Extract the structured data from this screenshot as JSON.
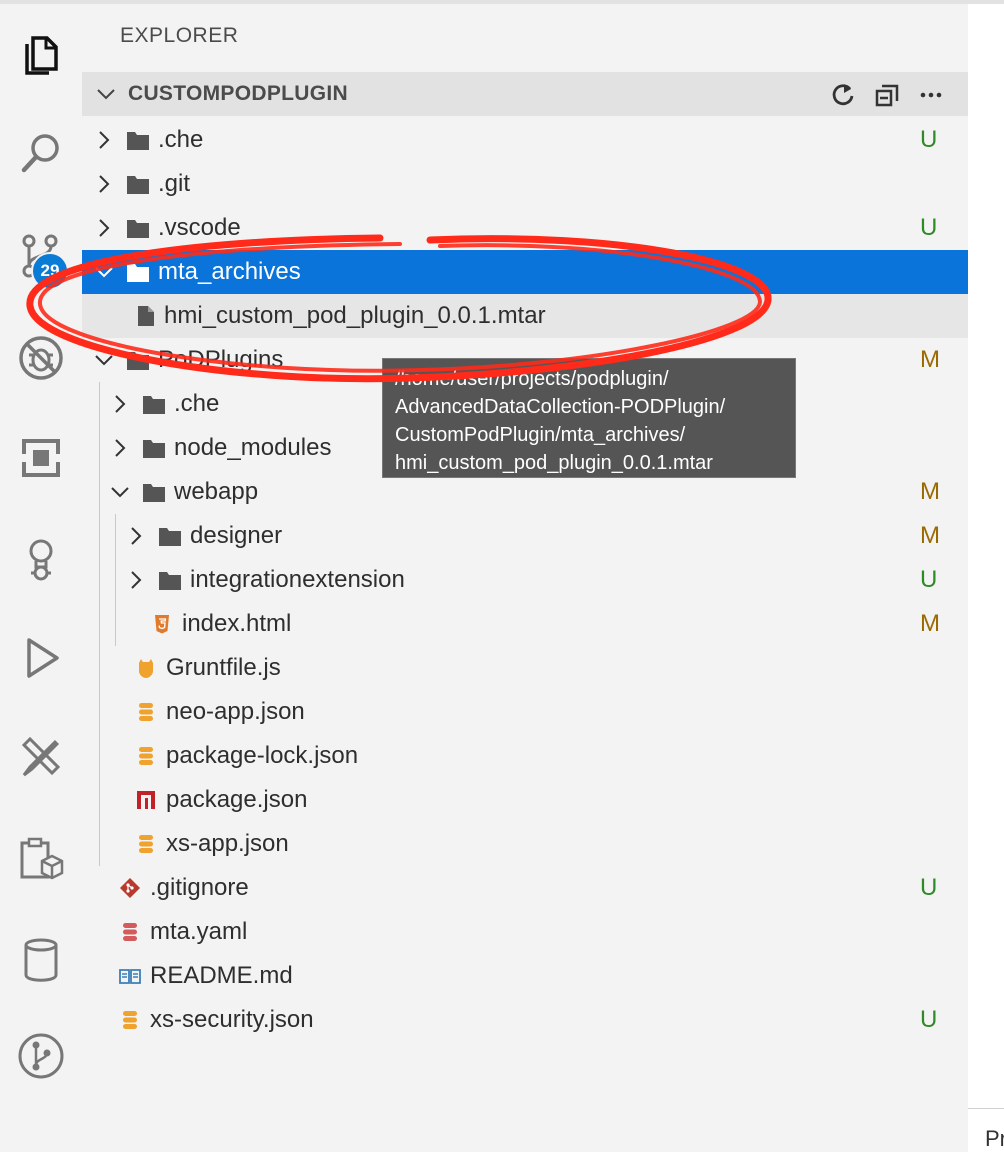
{
  "explorer": {
    "title": "EXPLORER"
  },
  "activity_bar": {
    "items": [
      {
        "icon": "files-icon"
      },
      {
        "icon": "search-icon"
      },
      {
        "icon": "source-control-icon",
        "badge": "29"
      },
      {
        "icon": "debug-disabled-icon"
      },
      {
        "icon": "extensions-icon"
      },
      {
        "icon": "lightbulb-gear-icon"
      },
      {
        "icon": "run-icon"
      },
      {
        "icon": "tools-icon"
      },
      {
        "icon": "clipboard-box-icon"
      },
      {
        "icon": "database-icon"
      },
      {
        "icon": "git-graph-icon"
      }
    ]
  },
  "section": {
    "title": "CUSTOMPODPLUGIN",
    "actions": [
      "refresh-icon",
      "collapse-all-icon",
      "more-icon"
    ]
  },
  "tree": [
    {
      "label": ".che",
      "status": "U"
    },
    {
      "label": ".git",
      "status": ""
    },
    {
      "label": ".vscode",
      "status": "U"
    },
    {
      "label": "mta_archives",
      "status": ""
    },
    {
      "label": "hmi_custom_pod_plugin_0.0.1.mtar",
      "status": ""
    },
    {
      "label": "PoDPlugins",
      "status": "M"
    },
    {
      "label": ".che",
      "status": ""
    },
    {
      "label": "node_modules",
      "status": ""
    },
    {
      "label": "webapp",
      "status": "M"
    },
    {
      "label": "designer",
      "status": "M"
    },
    {
      "label": "integrationextension",
      "status": "U"
    },
    {
      "label": "index.html",
      "status": "M"
    },
    {
      "label": "Gruntfile.js",
      "status": ""
    },
    {
      "label": "neo-app.json",
      "status": ""
    },
    {
      "label": "package-lock.json",
      "status": ""
    },
    {
      "label": "package.json",
      "status": ""
    },
    {
      "label": "xs-app.json",
      "status": ""
    },
    {
      "label": ".gitignore",
      "status": "U"
    },
    {
      "label": "mta.yaml",
      "status": ""
    },
    {
      "label": "README.md",
      "status": ""
    },
    {
      "label": "xs-security.json",
      "status": "U"
    }
  ],
  "tooltip": {
    "lines": [
      "/home/user/projects/podplugin/",
      "AdvancedDataCollection-PODPlugin/",
      "CustomPodPlugin/mta_archives/",
      "hmi_custom_pod_plugin_0.0.1.mtar"
    ]
  },
  "editor": {
    "tab_fragment": "Pr"
  },
  "colors": {
    "selection": "#0a74da",
    "badge": "#0a7cd6",
    "status_untracked": "#2e8b26",
    "status_modified": "#9a6a00",
    "annotation": "#ff2a1a"
  }
}
